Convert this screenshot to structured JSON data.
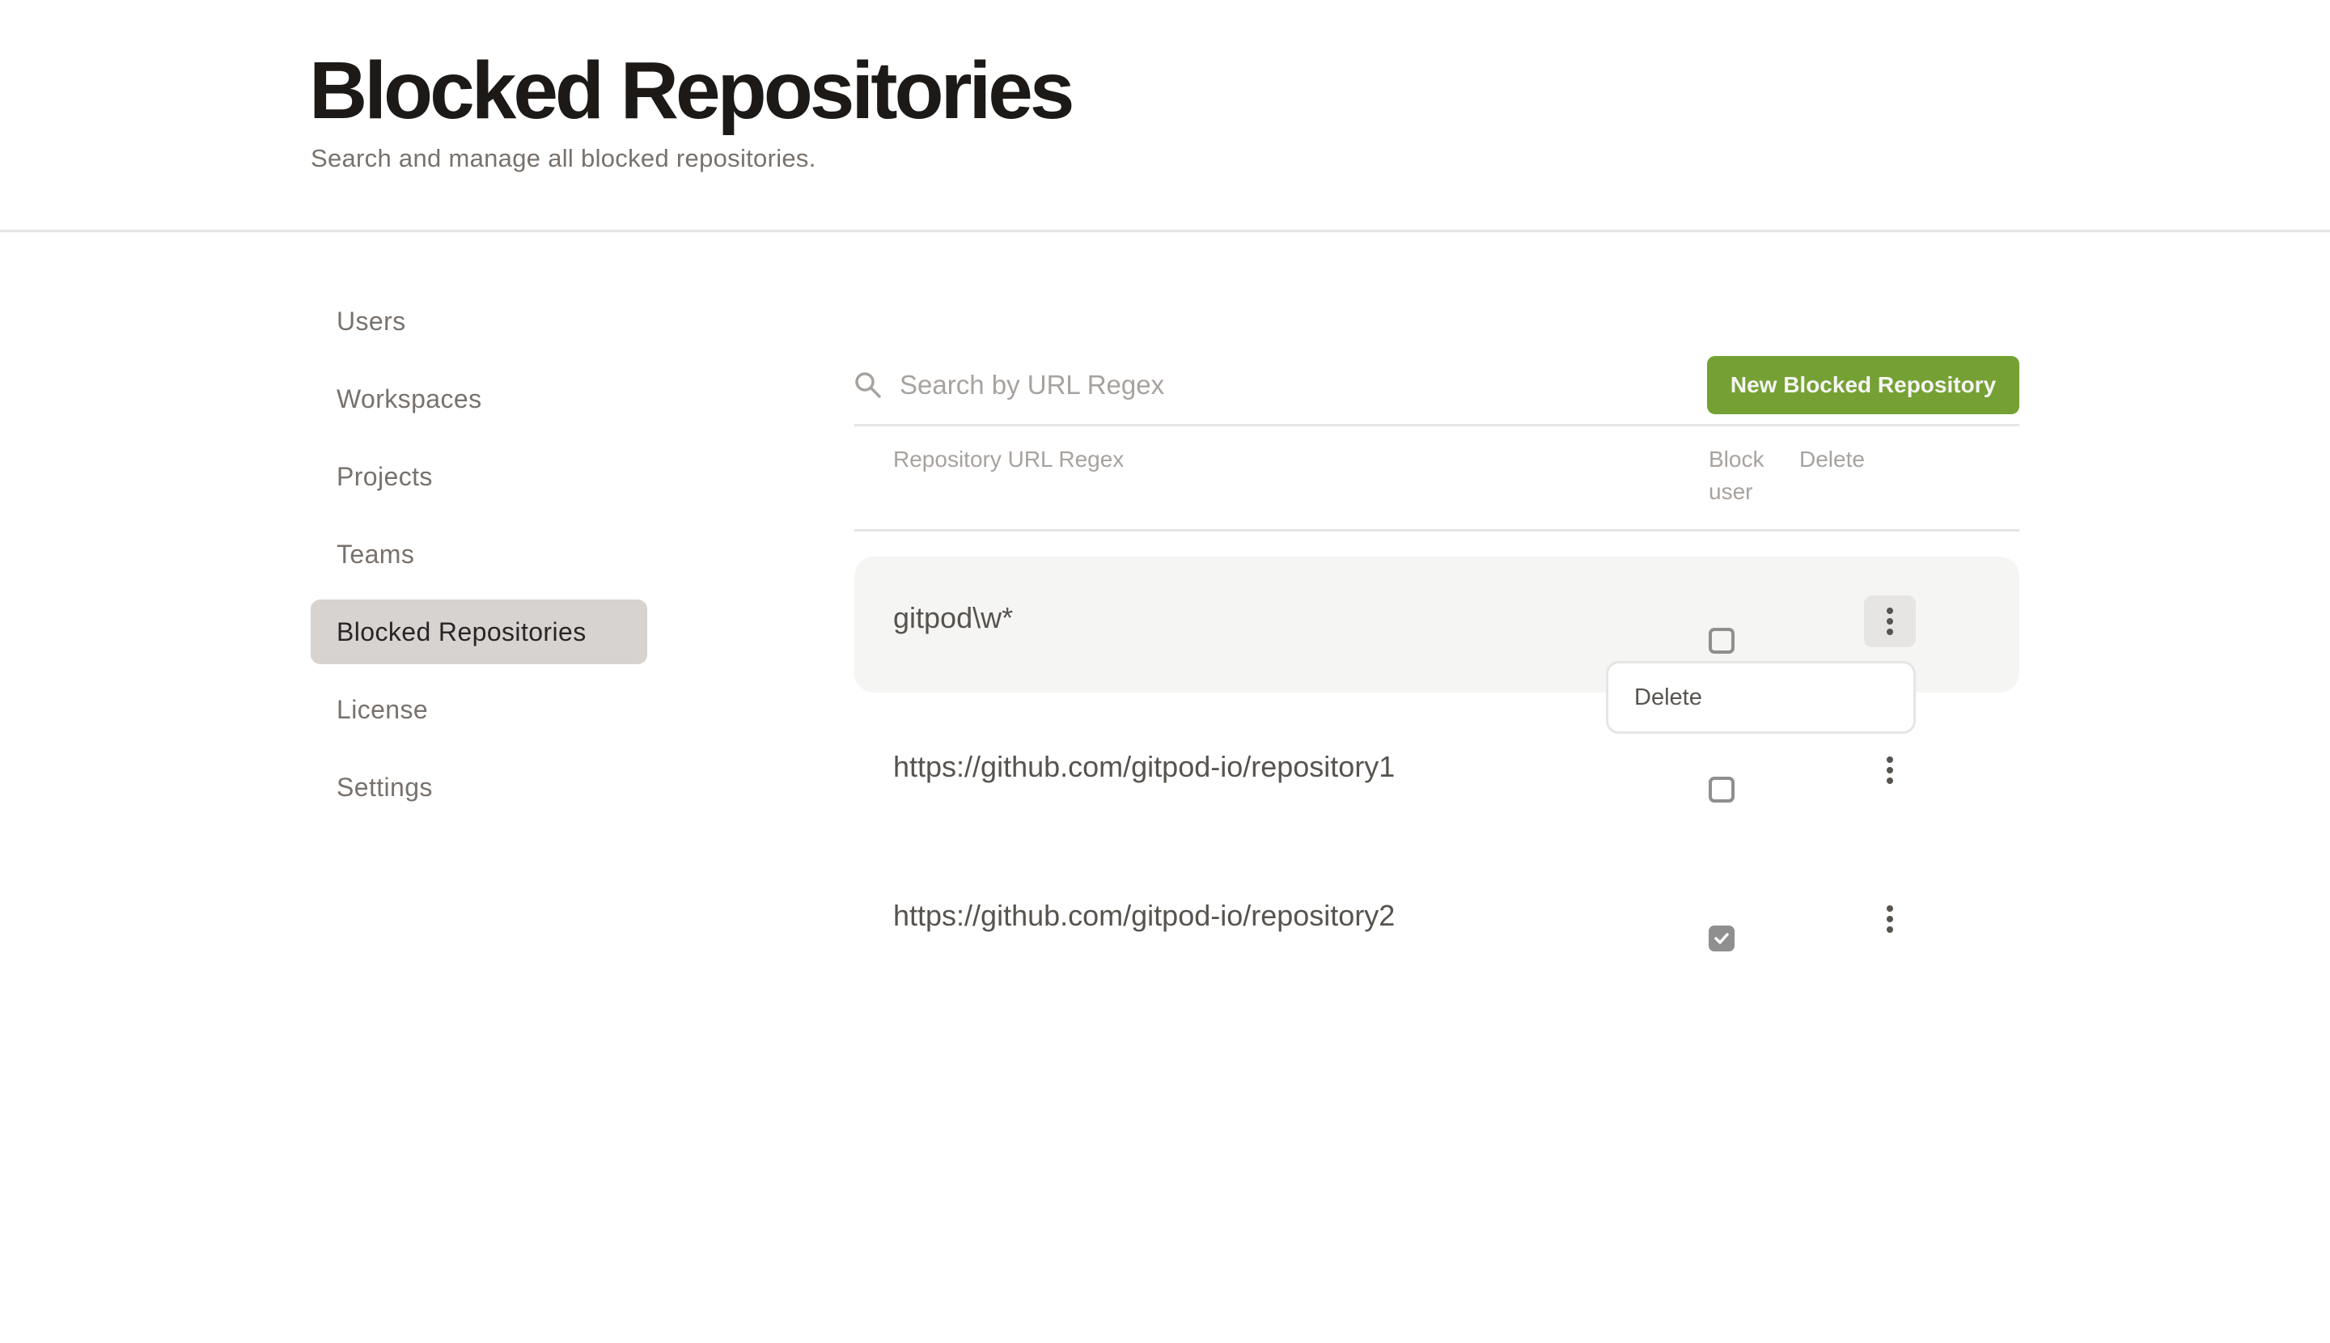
{
  "header": {
    "title": "Blocked Repositories",
    "subtitle": "Search and manage all blocked repositories."
  },
  "sidebar": {
    "items": [
      {
        "label": "Users",
        "active": false
      },
      {
        "label": "Workspaces",
        "active": false
      },
      {
        "label": "Projects",
        "active": false
      },
      {
        "label": "Teams",
        "active": false
      },
      {
        "label": "Blocked Repositories",
        "active": true
      },
      {
        "label": "License",
        "active": false
      },
      {
        "label": "Settings",
        "active": false
      }
    ]
  },
  "toolbar": {
    "search_icon": "search-icon",
    "search_placeholder": "Search by URL Regex",
    "search_value": "",
    "new_button_label": "New Blocked Repository"
  },
  "table": {
    "columns": {
      "url": "Repository URL Regex",
      "block_user": "Block user",
      "delete": "Delete"
    },
    "rows": [
      {
        "url": "gitpod\\w*",
        "block_user": false,
        "menu_open": true
      },
      {
        "url": "https://github.com/gitpod-io/repository1",
        "block_user": false,
        "menu_open": false
      },
      {
        "url": "https://github.com/gitpod-io/repository2",
        "block_user": true,
        "menu_open": false
      }
    ],
    "row_menu": {
      "items": [
        "Delete"
      ]
    }
  },
  "colors": {
    "accent": "#75a134",
    "active_nav_bg": "#d6d3d1",
    "row_hover_bg": "#f5f5f4",
    "checkbox": "#8f8f8f"
  }
}
